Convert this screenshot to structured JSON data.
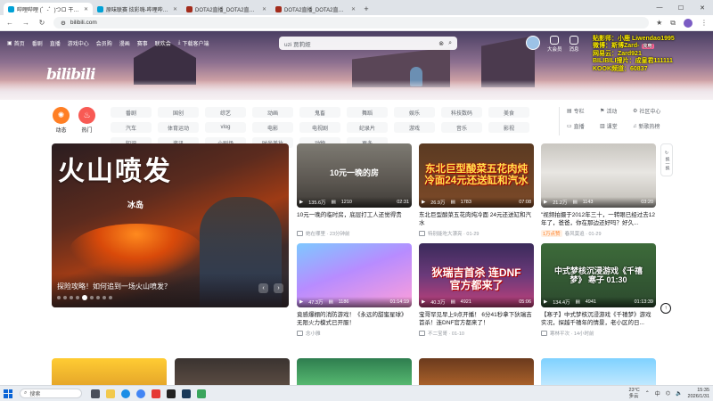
{
  "browser": {
    "tabs": [
      {
        "title": "哔哩哔哩 (゜-゜)つロ 干杯~-bilibili",
        "active": true
      },
      {
        "title": "原味联赛 炫彩嗨-哔哩哔哩_bilibili",
        "active": false
      },
      {
        "title": "DOTA2直播_DOTA2直播解说视频",
        "active": false
      },
      {
        "title": "DOTA2直播_DOTA2直播解说视频",
        "active": false
      }
    ],
    "url": "bilibili.com"
  },
  "header": {
    "nav": [
      "首页",
      "番剧",
      "直播",
      "游戏中心",
      "会员购",
      "漫画",
      "赛事",
      "联欢会",
      "下载客户端"
    ],
    "logo_text": "bilibili",
    "search": {
      "value": "uzi 贾莉娅"
    },
    "user_icons": [
      "大会员",
      "消息"
    ]
  },
  "stream_overlay": {
    "lines": [
      "贴影师：小鹿 Liwendao1995",
      "微博：斯博Zard-",
      "网易云：Zard921",
      "BILIBILI搜片：成皇君111111",
      "KOOK频道：60837"
    ],
    "gift_label": "充电"
  },
  "channels": {
    "dynamic": "动态",
    "hot": "热门",
    "grid": [
      [
        "番剧",
        "国创",
        "综艺",
        "动画",
        "鬼畜",
        "舞蹈",
        "娱乐",
        "科技数码",
        "美食",
        "汽车",
        "体育运动",
        "vlog"
      ],
      [
        "电影",
        "电视剧",
        "纪录片",
        "游戏",
        "音乐",
        "影视",
        "知识",
        "资讯",
        "小剧场",
        "时尚美妆",
        "动物",
        "更多"
      ]
    ],
    "right_links": [
      "专栏",
      "活动",
      "社区中心",
      "直播",
      "课堂",
      "新歌热榜"
    ]
  },
  "carousel": {
    "headline": "火山喷发",
    "sub": "冰岛",
    "caption": "探险攻略！如何追到一场火山喷发？",
    "dots": 9,
    "active_dot": 4
  },
  "videos": [
    {
      "thumb_text": "10元一晚的房",
      "views": "135.6万",
      "danmaku": "1210",
      "duration": "02:31",
      "title": "10元一晚的临时房，底层打工人还觉得贵",
      "meta": "她在哪里 · 23分钟前",
      "badge": ""
    },
    {
      "thumb_text": "东北巨型酸菜五花肉炖冷面24元还送缸和汽水",
      "views": "26.9万",
      "danmaku": "1783",
      "duration": "07:08",
      "title": "东北巨型酸菜五花肉炖冷面 24元还送缸和汽水",
      "meta": "特别能吃大漂亮 · 01-29",
      "badge": ""
    },
    {
      "thumb_text": "",
      "views": "21.2万",
      "danmaku": "1143",
      "duration": "03:20",
      "title": "\"视频拍摄于2012年三十，一转眼已经过去12年了，爸爸，你在那边还好吗？好久...",
      "meta": "春风莫追 · 01-29",
      "badge": "1万点赞"
    },
    {
      "thumb_text": "",
      "views": "47.3万",
      "danmaku": "1186",
      "duration": "01:14:19",
      "title": "竟感爆棚的消防游戏！《永远的甜蜜星球》无限火力模式已开服！",
      "meta": "念小雅",
      "badge": ""
    },
    {
      "thumb_text": "狄瑞吉首杀 连DNF官方都来了",
      "views": "40.3万",
      "danmaku": "4921",
      "duration": "05:06",
      "title": "宝哥罕见早上9点开播！ 6分41秒拿下狄瑞吉首杀！连DNF官方都来了！",
      "meta": "不二宝哥 · 01-10",
      "badge": ""
    },
    {
      "thumb_text": "中式梦核沉浸游戏《千禧梦》 寒子 01:30",
      "views": "134.4万",
      "danmaku": "4941",
      "duration": "01:13:39",
      "title": "【寒子】中式梦核沉浸游戏《千禧梦》游戏实况，探越千禧年的情景，老小区的日...",
      "meta": "寒林平次 · 14小时前",
      "badge": ""
    }
  ],
  "side": {
    "refresh": "换一换"
  },
  "taskbar": {
    "search": "搜索",
    "weather_temp": "23°C",
    "weather_desc": "多云",
    "lang": "中",
    "time": "15:35",
    "date": "2026/1/31"
  }
}
